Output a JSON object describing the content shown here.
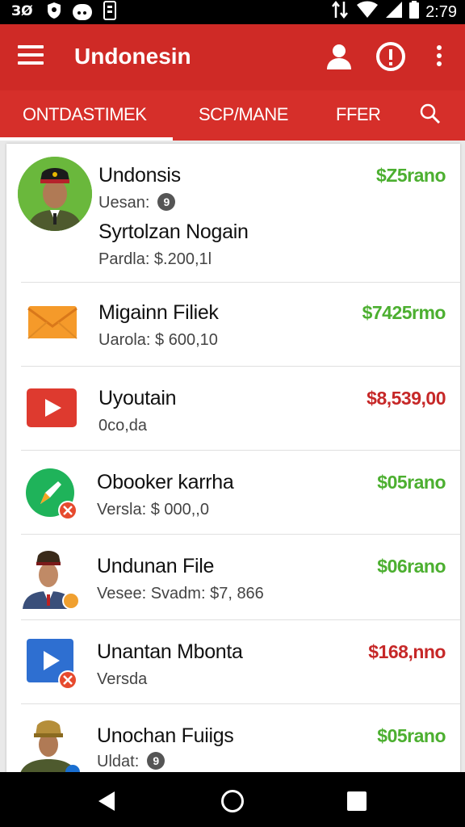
{
  "status_bar": {
    "left_icons": [
      "notification-icon-a",
      "notification-icon-b",
      "notification-icon-c",
      "notification-icon-d"
    ],
    "time": "2:79"
  },
  "app_bar": {
    "title": "Undonesin"
  },
  "tabs": [
    {
      "label": "ONTDASTIMEK",
      "selected": true
    },
    {
      "label": "SCP/MANE",
      "selected": false
    },
    {
      "label": "FFER",
      "selected": false
    }
  ],
  "rows": [
    {
      "title": "Undonsis",
      "subtitle": "Uesan:",
      "badge": "9",
      "title2": "Syrtolzan Nogain",
      "subtitle2": "Pardla: $.200,1l",
      "price": "$Z5rano",
      "price_color": "#4caf30",
      "icon": "soldier-avatar-icon"
    },
    {
      "title": "Migainn Filiek",
      "subtitle": "Uarola: $ 600,10",
      "price": "$7425rmo",
      "price_color": "#4caf30",
      "icon": "mail-envelope-icon"
    },
    {
      "title": "Uyoutain",
      "subtitle": "0co,da",
      "price": "$8,539,00",
      "price_color": "#c62828",
      "icon": "video-play-icon"
    },
    {
      "title": "Obooker karrha",
      "subtitle": "Versla: $ 000,,0",
      "price": "$05rano",
      "price_color": "#4caf30",
      "icon": "green-pen-app-icon"
    },
    {
      "title": "Undunan File",
      "subtitle": "Vesee: Svadm: $7, 866",
      "price": "$06rano",
      "price_color": "#4caf30",
      "icon": "officer-avatar-icon"
    },
    {
      "title": "Unantan Mbonta",
      "subtitle": "Versda",
      "price": "$168,nno",
      "price_color": "#c62828",
      "icon": "blue-play-app-icon"
    },
    {
      "title": "Unochan Fuiigs",
      "subtitle": "Uldat:",
      "badge": "9",
      "price": "$05rano",
      "price_color": "#4caf30",
      "icon": "soldier-small-avatar-icon"
    }
  ],
  "colors": {
    "app_bar": "#cf2a26",
    "tab_bar": "#d62f2a",
    "price_green": "#4caf30",
    "price_red": "#c62828"
  }
}
